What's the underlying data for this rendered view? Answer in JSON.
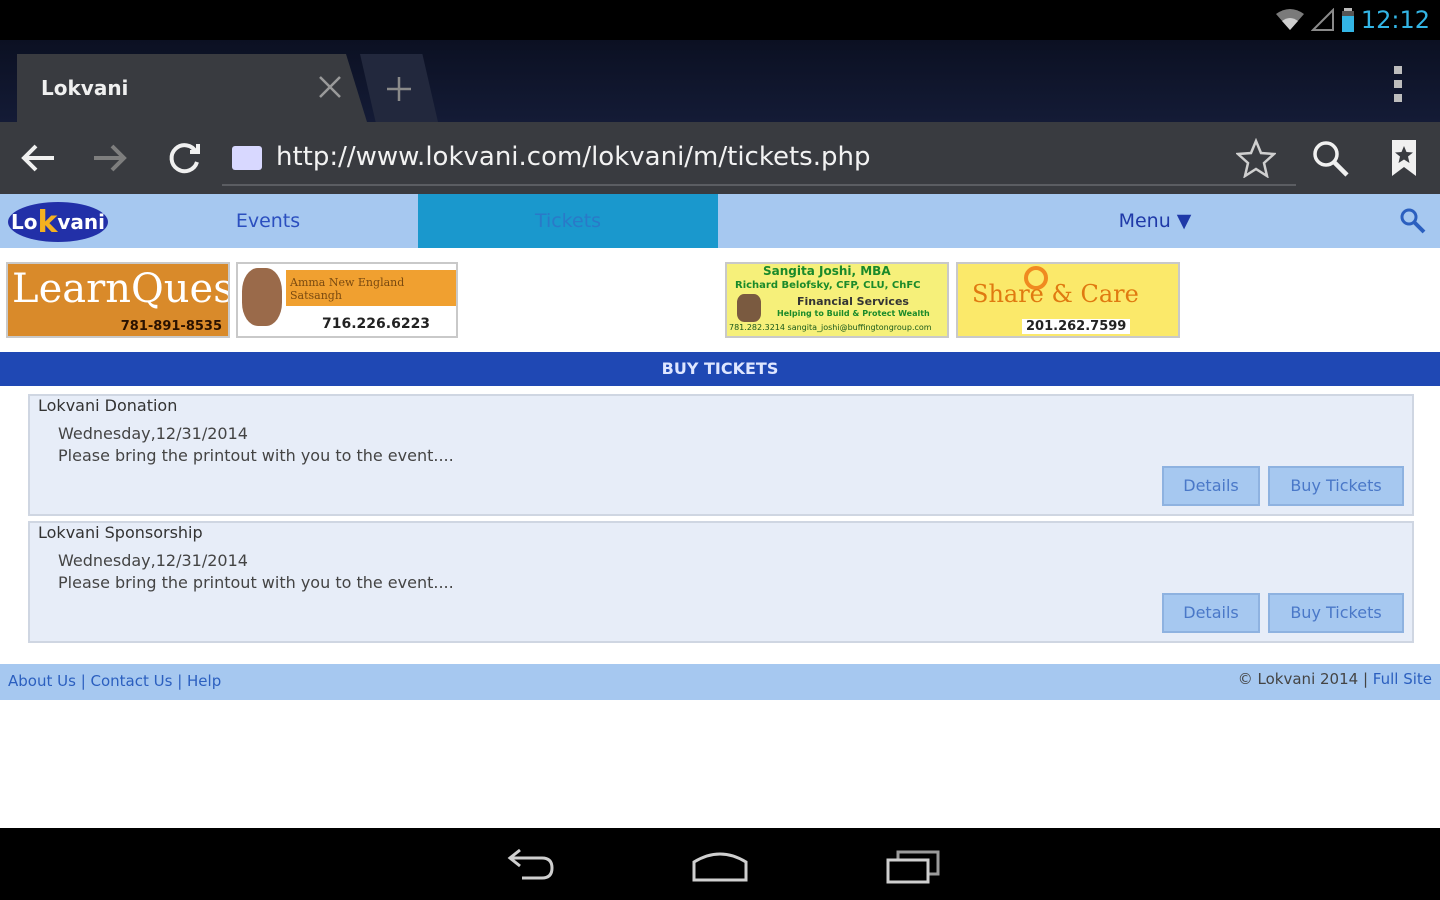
{
  "status": {
    "time": "12:12"
  },
  "tab": {
    "title": "Lokvani"
  },
  "url": {
    "text": "http://www.lokvani.com/lokvani/m/tickets.php"
  },
  "site_nav": {
    "logo_prefix": "Lo",
    "logo_k": "k",
    "logo_suffix": "vani",
    "items": [
      {
        "label": "Events"
      },
      {
        "label": "Tickets"
      },
      {
        "label": "Menu ▼"
      }
    ]
  },
  "ads": {
    "learnquest": {
      "brand": "LearnQuest",
      "phone": "781-891-8535"
    },
    "amma": {
      "banner": "Amma New England Satsangh",
      "phone": "716.226.6223"
    },
    "sangita": {
      "line1": "Sangita Joshi, MBA",
      "line2": "Richard Belofsky, CFP, CLU, ChFC",
      "line3": "Financial Services",
      "line4": "Helping to Build & Protect Wealth",
      "line5": "781.282.3214 sangita_joshi@buffingtongroup.com"
    },
    "sharecare": {
      "brand": "Share & Care",
      "phone": "201.262.7599"
    }
  },
  "section": {
    "title": "BUY TICKETS"
  },
  "tickets": [
    {
      "name": "Lokvani Donation",
      "date": "Wednesday,12/31/2014",
      "desc": "Please bring the printout with you to the event....",
      "details_label": "Details",
      "buy_label": "Buy Tickets"
    },
    {
      "name": "Lokvani Sponsorship",
      "date": "Wednesday,12/31/2014",
      "desc": "Please bring the printout with you to the event....",
      "details_label": "Details",
      "buy_label": "Buy Tickets"
    }
  ],
  "footer": {
    "about": "About Us",
    "contact": "Contact Us",
    "help": "Help",
    "sep": " | ",
    "copyright": "© Lokvani 2014",
    "full_site": "Full Site"
  },
  "colors": {
    "accent": "#33b5e5",
    "site_nav": "#a6c8f0",
    "section_bar": "#1f48b4",
    "tickets_tab": "#1a98cd"
  }
}
